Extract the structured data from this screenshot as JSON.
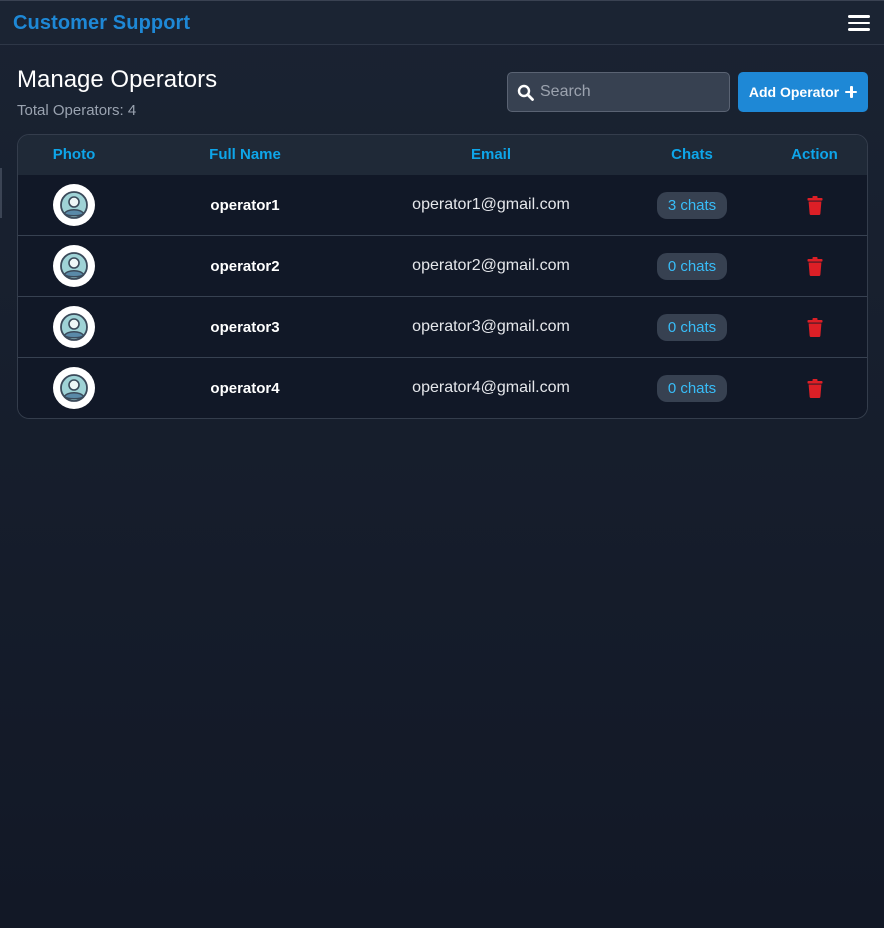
{
  "app": {
    "title": "Customer Support",
    "menu_icon": "hamburger-menu-icon"
  },
  "page": {
    "title": "Manage Operators",
    "subtitle": "Total Operators: 4"
  },
  "search": {
    "placeholder": "Search",
    "value": "",
    "icon": "search-icon"
  },
  "actions": {
    "add_label": "Add Operator",
    "add_icon": "plus-icon"
  },
  "table": {
    "columns": [
      "Photo",
      "Full Name",
      "Email",
      "Chats",
      "Action"
    ],
    "rows": [
      {
        "name": "operator1",
        "email": "operator1@gmail.com",
        "chats": "3 chats",
        "photo_icon": "user-avatar-icon",
        "action_icon": "trash-icon"
      },
      {
        "name": "operator2",
        "email": "operator2@gmail.com",
        "chats": "0 chats",
        "photo_icon": "user-avatar-icon",
        "action_icon": "trash-icon"
      },
      {
        "name": "operator3",
        "email": "operator3@gmail.com",
        "chats": "0 chats",
        "photo_icon": "user-avatar-icon",
        "action_icon": "trash-icon"
      },
      {
        "name": "operator4",
        "email": "operator4@gmail.com",
        "chats": "0 chats",
        "photo_icon": "user-avatar-icon",
        "action_icon": "trash-icon"
      }
    ]
  },
  "colors": {
    "brand": "#1e88d6",
    "header_text": "#0ea5e9",
    "chip_text": "#38bdf8",
    "delete": "#dc1f26",
    "background": "#151d2b"
  }
}
